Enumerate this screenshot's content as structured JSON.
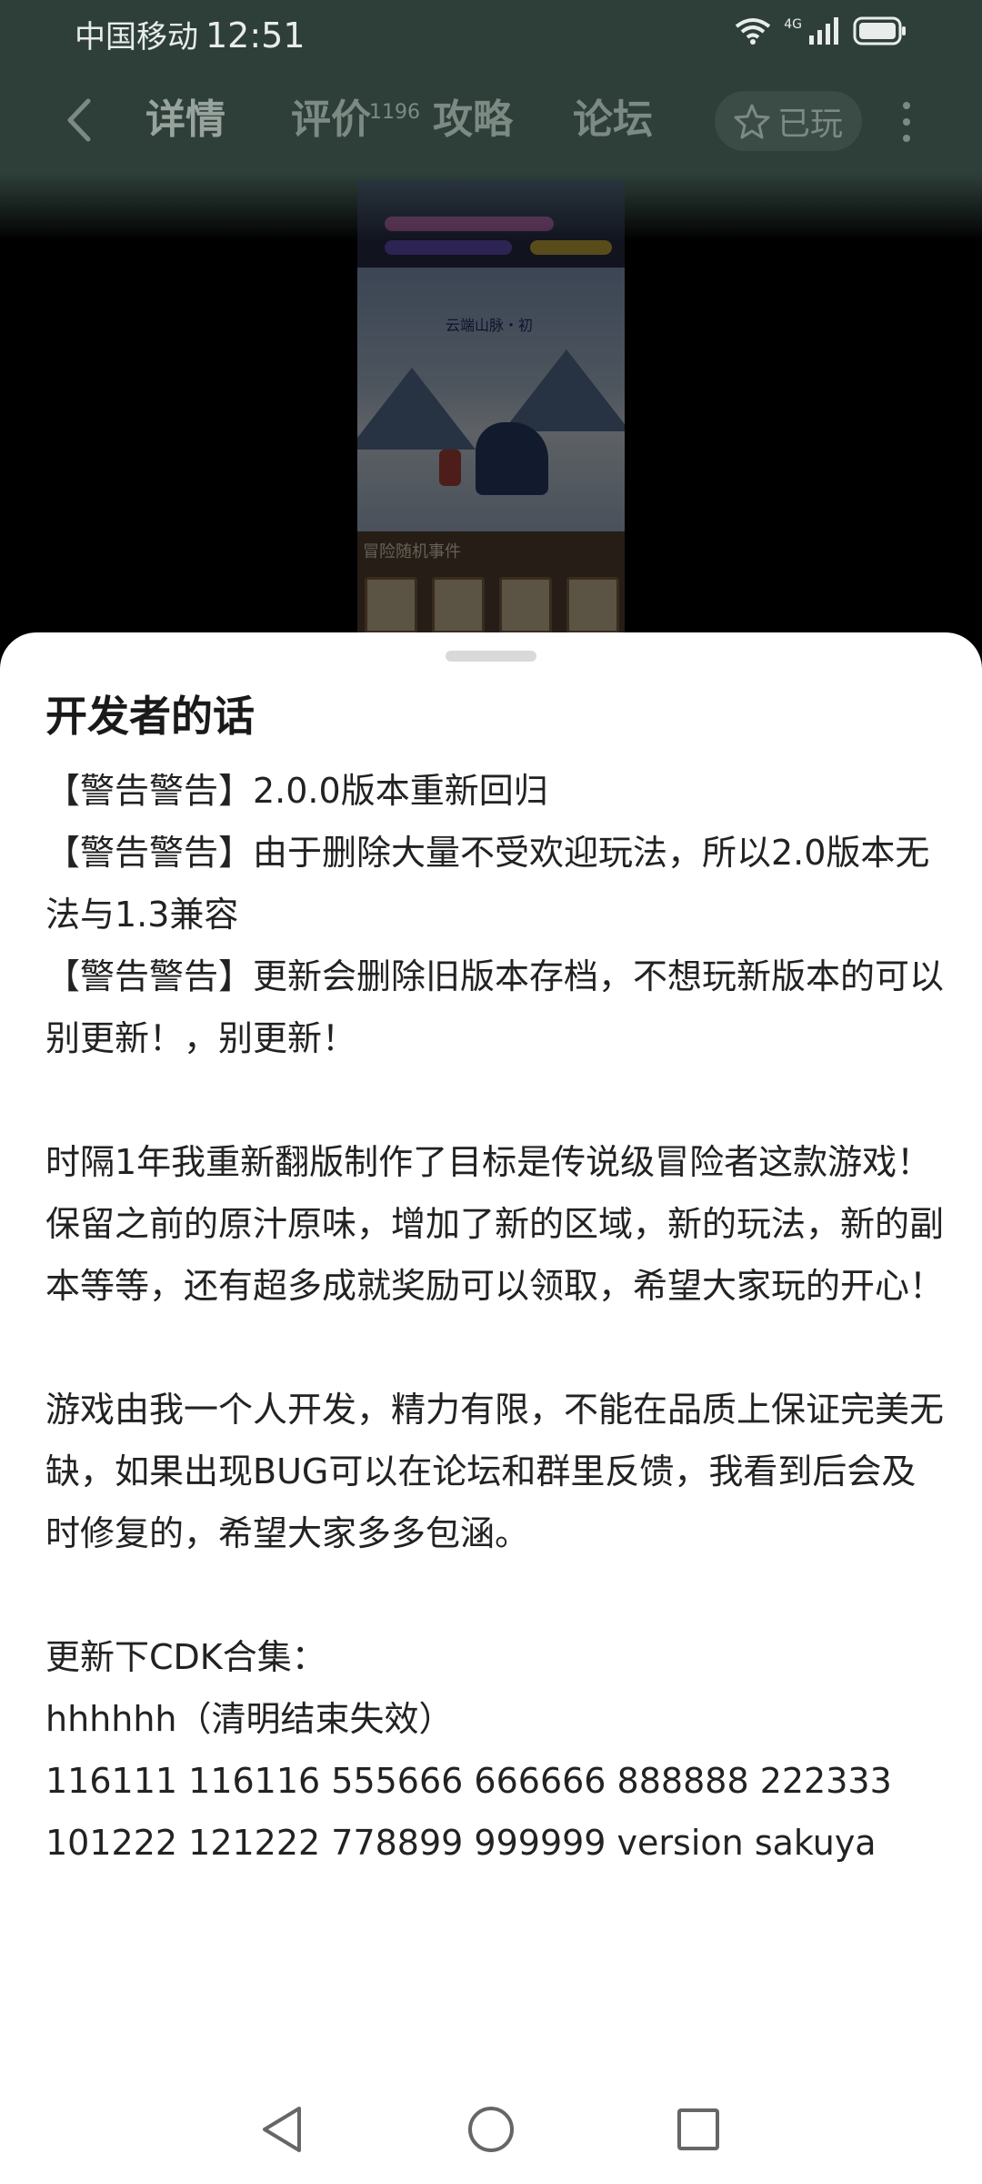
{
  "status_bar": {
    "carrier": "中国移动",
    "time": "12:51",
    "network": "4G"
  },
  "nav": {
    "tabs": [
      {
        "label": "详情",
        "active": true
      },
      {
        "label": "评价",
        "badge": "1196"
      },
      {
        "label": "攻略"
      },
      {
        "label": "论坛"
      }
    ],
    "played_label": "已玩"
  },
  "game_preview": {
    "area_title": "云端山脉・初",
    "event_label": "冒险随机事件"
  },
  "sheet": {
    "title": "开发者的话",
    "paragraphs": [
      "【警告警告】2.0.0版本重新回归",
      "【警告警告】由于删除大量不受欢迎玩法，所以2.0版本无法与1.3兼容",
      "【警告警告】更新会删除旧版本存档，不想玩新版本的可以别更新！，别更新！",
      "",
      "时隔1年我重新翻版制作了目标是传说级冒险者这款游戏！保留之前的原汁原味，增加了新的区域，新的玩法，新的副本等等，还有超多成就奖励可以领取，希望大家玩的开心！",
      "",
      "游戏由我一个人开发，精力有限，不能在品质上保证完美无缺，如果出现BUG可以在论坛和群里反馈，我看到后会及时修复的，希望大家多多包涵。",
      "",
      "更新下CDK合集：",
      "hhhhhh（清明结束失效）",
      "116111 116116 555666 666666 888888 222333",
      "101222 121222 778899 999999 version sakuya"
    ]
  },
  "colors": {
    "header_bg": "#2e3f39",
    "tab_text": "#7d8a84",
    "sheet_bg": "#ffffff",
    "body_text": "#222222"
  }
}
